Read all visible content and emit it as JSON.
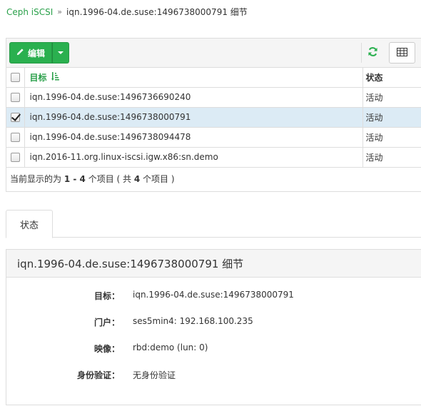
{
  "breadcrumb": {
    "link": "Ceph iSCSI",
    "separator": "»",
    "current": "iqn.1996-04.de.suse:1496738000791 细节"
  },
  "toolbar": {
    "edit_label": "编辑",
    "icons": [
      "pencil-icon",
      "caret-down-icon",
      "refresh-icon",
      "table-columns-icon"
    ],
    "accent": "#2ab04f"
  },
  "table": {
    "headers": {
      "target": "目标",
      "status": "状态"
    },
    "rows": [
      {
        "target": "iqn.1996-04.de.suse:1496736690240",
        "status": "活动",
        "checked": false
      },
      {
        "target": "iqn.1996-04.de.suse:1496738000791",
        "status": "活动",
        "checked": true
      },
      {
        "target": "iqn.1996-04.de.suse:1496738094478",
        "status": "活动",
        "checked": false
      },
      {
        "target": "iqn.2016-11.org.linux-iscsi.igw.x86:sn.demo",
        "status": "活动",
        "checked": false
      }
    ],
    "footer": {
      "prefix": "当前显示的为 ",
      "range": "1 - 4",
      "middle": " 个项目 ( 共 ",
      "total": "4",
      "suffix": " 个项目 )"
    }
  },
  "tabs": [
    {
      "label": "状态",
      "active": true
    }
  ],
  "detail": {
    "title": "iqn.1996-04.de.suse:1496738000791 细节",
    "fields": [
      {
        "key": "目标：",
        "value": "iqn.1996-04.de.suse:1496738000791"
      },
      {
        "key": "门户：",
        "value": "ses5min4: 192.168.100.235"
      },
      {
        "key": "映像：",
        "value": "rbd:demo (lun: 0)"
      },
      {
        "key": "身份验证：",
        "value": "无身份验证"
      }
    ]
  }
}
